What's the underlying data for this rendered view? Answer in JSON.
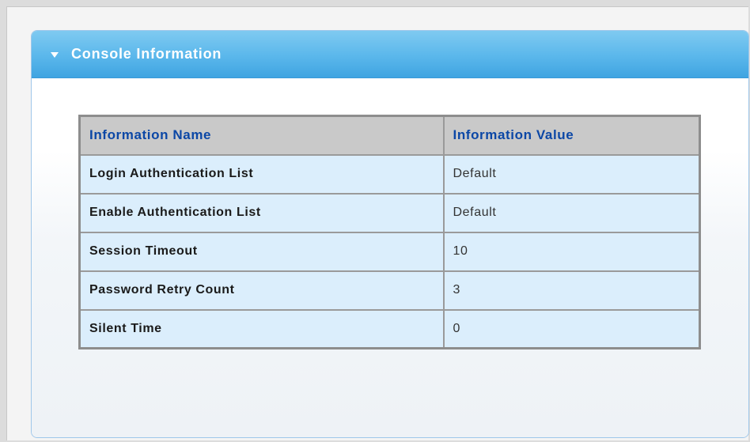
{
  "panel": {
    "title": "Console Information"
  },
  "table": {
    "headers": {
      "name": "Information Name",
      "value": "Information Value"
    },
    "rows": [
      {
        "name": "Login Authentication List",
        "value": "Default"
      },
      {
        "name": "Enable Authentication List",
        "value": "Default"
      },
      {
        "name": "Session Timeout",
        "value": "10"
      },
      {
        "name": "Password Retry Count",
        "value": "3"
      },
      {
        "name": "Silent Time",
        "value": "0"
      }
    ]
  },
  "colors": {
    "header_gradient_top": "#7fcaf1",
    "header_gradient_bottom": "#3fa4e1",
    "table_header_bg": "#c9c9c9",
    "table_header_text": "#0b47a6",
    "table_row_bg": "#dbeefc"
  },
  "icons": {
    "panel_toggle": "triangle-down-icon"
  }
}
